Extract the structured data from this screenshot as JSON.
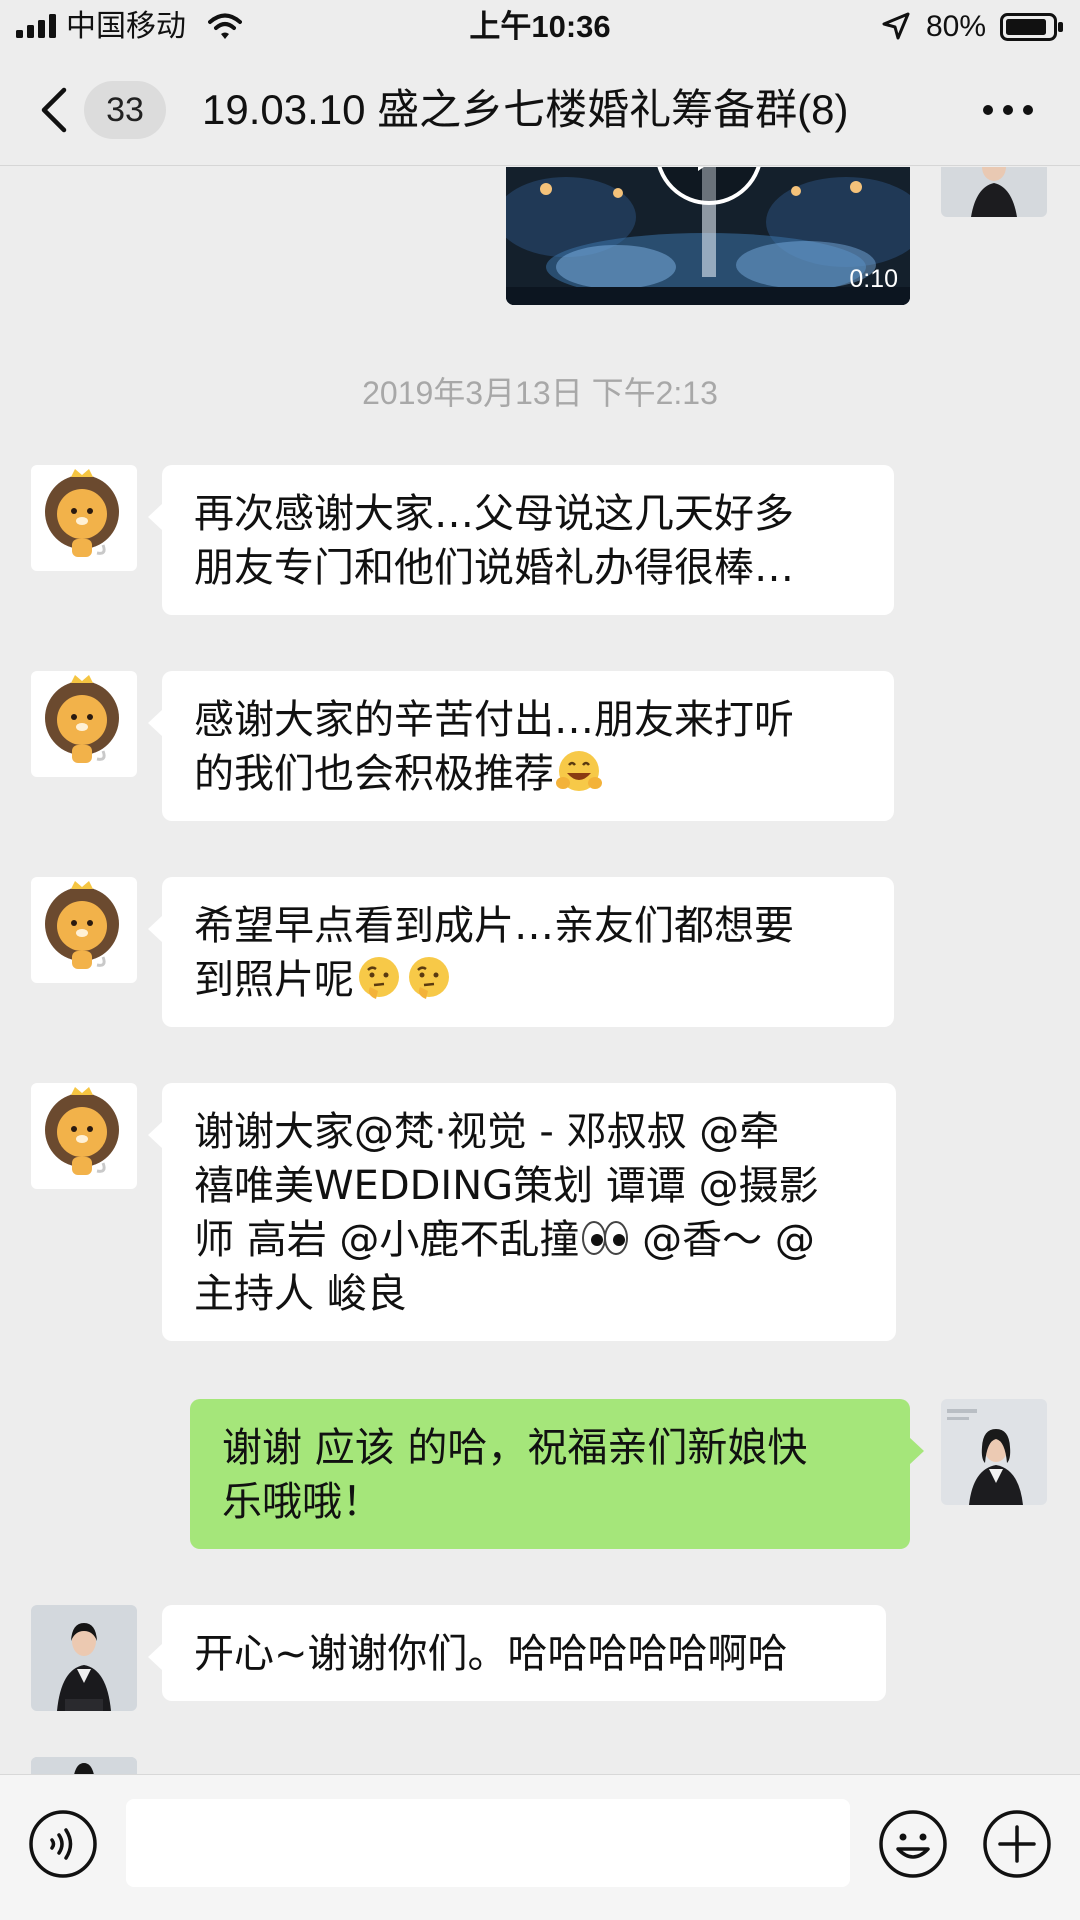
{
  "status_bar": {
    "carrier": "中国移动",
    "time": "上午10:36",
    "battery": "80%"
  },
  "nav": {
    "back_badge": "33",
    "title": "19.03.10 盛之乡七楼婚礼筹备群(8)"
  },
  "video": {
    "duration": "0:10"
  },
  "timestamp": "2019年3月13日 下午2:13",
  "messages": [
    {
      "side": "left",
      "avatar": "lion-avatar",
      "lines": [
        "再次感谢大家…父母说这几天好多",
        "朋友专门和他们说婚礼办得很棒…"
      ]
    },
    {
      "side": "left",
      "avatar": "lion-avatar",
      "lines": [
        "感谢大家的辛苦付出…朋友来打听",
        "的我们也会积极推荐"
      ],
      "emoji": [
        "grinning-hands-emoji"
      ]
    },
    {
      "side": "left",
      "avatar": "lion-avatar",
      "lines": [
        "希望早点看到成片…亲友们都想要",
        "到照片呢"
      ],
      "emoji": [
        "thinking-emoji",
        "thinking-emoji"
      ]
    },
    {
      "side": "left",
      "avatar": "lion-avatar",
      "lines": [
        "谢谢大家@梵·视觉 - 邓叔叔 @牵",
        "禧唯美WEDDING策划 谭谭 @摄影",
        "师 高岩 @小鹿不乱撞",
        " @香～ @",
        "主持人 峻良"
      ],
      "emoji": [
        "eyes-emoji"
      ]
    },
    {
      "side": "right",
      "avatar": "woman-avatar",
      "lines": [
        "谢谢 应该 的哈，祝福亲们新娘快",
        "乐哦哦！"
      ]
    },
    {
      "side": "left",
      "avatar": "woman-avatar",
      "lines": [
        "开心~谢谢你们。哈哈哈哈哈啊哈"
      ]
    }
  ],
  "colors": {
    "background": "#ededed",
    "bubble_self": "#a5e67a",
    "bubble_other": "#ffffff",
    "timestamp": "#a8a8a8"
  },
  "icons": {
    "back": "chevron-left-icon",
    "more": "more-dots-icon",
    "voice": "voice-icon",
    "emoji": "smiley-icon",
    "plus": "plus-icon"
  }
}
